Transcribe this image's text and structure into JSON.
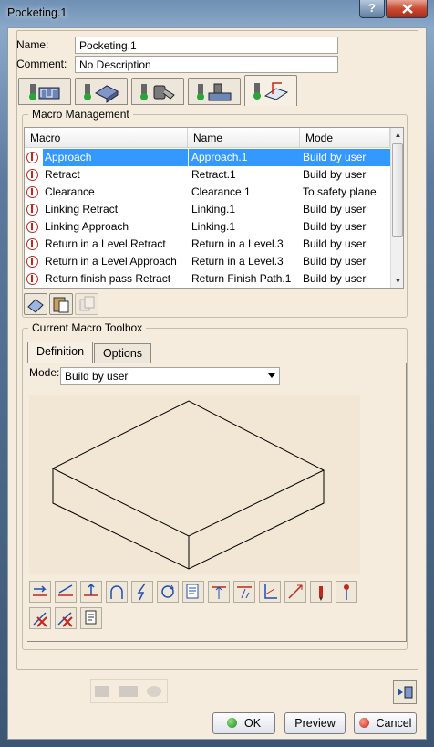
{
  "window": {
    "title": "Pocketing.1",
    "help_label": "?",
    "close_label": "x"
  },
  "name_label": "Name:",
  "name_value": "Pocketing.1",
  "comment_label": "Comment:",
  "comment_value": "No Description",
  "icon_tabs": [
    "strategy-tab-icon",
    "geometry-tab-icon",
    "tool-tab-icon",
    "feeds-speeds-tab-icon",
    "macros-tab-icon"
  ],
  "macro_management": {
    "title": "Macro Management",
    "columns": [
      "Macro",
      "Name",
      "Mode"
    ],
    "rows": [
      {
        "macro": "Approach",
        "name": "Approach.1",
        "mode": "Build by user"
      },
      {
        "macro": "Retract",
        "name": "Retract.1",
        "mode": "Build by user"
      },
      {
        "macro": "Clearance",
        "name": "Clearance.1",
        "mode": "To safety plane"
      },
      {
        "macro": "Linking Retract",
        "name": "Linking.1",
        "mode": "Build by user"
      },
      {
        "macro": "Linking Approach",
        "name": "Linking.1",
        "mode": "Build by user"
      },
      {
        "macro": "Return in a Level Retract",
        "name": "Return in a Level.3",
        "mode": "Build by user"
      },
      {
        "macro": "Return in a Level Approach",
        "name": "Return in a Level.3",
        "mode": "Build by user"
      },
      {
        "macro": "Return finish pass Retract",
        "name": "Return Finish Path.1",
        "mode": "Build by user"
      }
    ],
    "selected_row": "Approach"
  },
  "toolbox": {
    "title": "Current Macro Toolbox",
    "tabs": [
      "Definition",
      "Options"
    ],
    "mode_label": "Mode:",
    "mode_value": "Build by user"
  },
  "buttons": {
    "ok": "OK",
    "preview": "Preview",
    "cancel": "Cancel"
  },
  "colors": {
    "background": "#f5ecdd",
    "selection": "#3399ff",
    "mode_red": "#c0281b"
  }
}
